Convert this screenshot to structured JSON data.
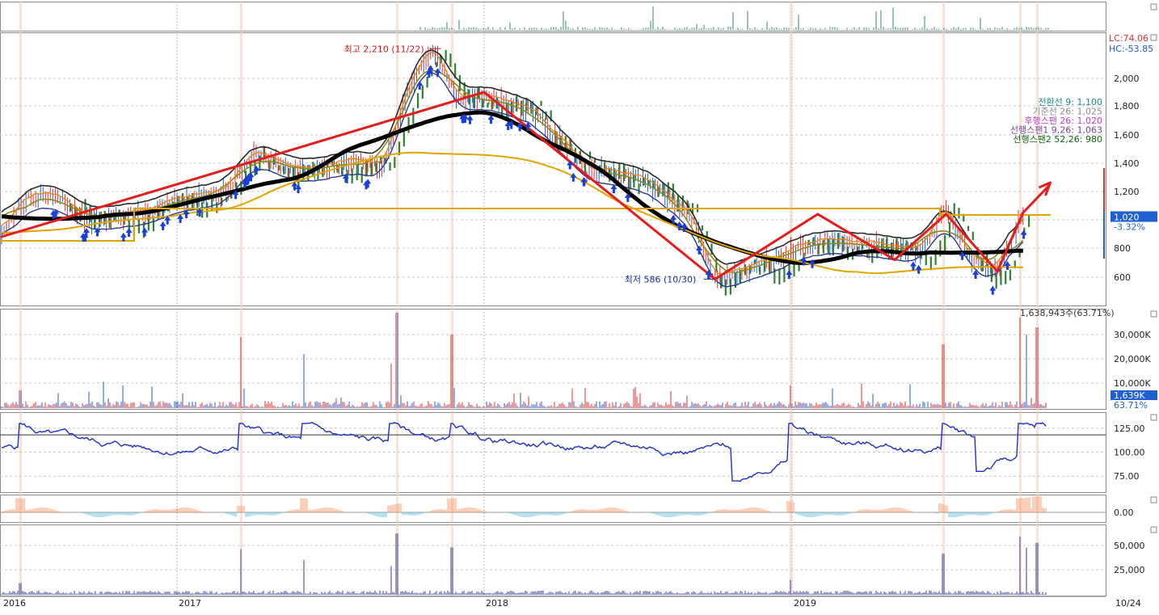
{
  "colors": {
    "price_up": "#e03030",
    "price_down": "#1f5fd0",
    "ma_long": "#000000",
    "ma_mid": "#6a6a6a",
    "ma_yellow": "#e0a500",
    "trend_arrow": "#e51c1c",
    "ichimoku_cloud": "#0a6b10",
    "bollinger": "#000000",
    "buy_signal": "#1b3fd6",
    "volume_up": "#e03030",
    "volume_down": "#1f5fd0",
    "osc_line": "#1d2fc8",
    "macd_pos": "#f4a070",
    "macd_neg": "#6ec6e0",
    "accent_orange": "#f08010",
    "ichimoku_leading1": "#7a3f9a",
    "ichimoku_leading2": "#116611"
  },
  "xaxis": {
    "labels": [
      "2016",
      "2017",
      "2018",
      "2019"
    ],
    "right_label": "10/24"
  },
  "price_panel": {
    "yticks": [
      "2,000",
      "1,800",
      "1,600",
      "1,400",
      "1,200",
      "800",
      "600"
    ],
    "lc_label": "LC:74.06",
    "hc_label": "HC:-53.85",
    "high_annotation": "최고 2,210 (11/22)",
    "low_annotation": "최저 586 (10/30)",
    "current_price": "1,020",
    "current_change": "-3.32%",
    "legend": [
      {
        "text": "전환선 9: 1,100",
        "color": "#1a8a8a"
      },
      {
        "text": "기준선 26: 1,025",
        "color": "#8a8a8a"
      },
      {
        "text": "후행스팬 26: 1,020",
        "color": "#c23fc2"
      },
      {
        "text": "선행스팬1 9,26: 1,063",
        "color": "#7a3f9a"
      },
      {
        "text": "선행스팬2 52,26: 980",
        "color": "#116611"
      }
    ]
  },
  "volume_panel": {
    "yticks": [
      "30,000K",
      "20,000K",
      "10,000K"
    ],
    "max_label": "1,638,943주(63.71%)",
    "current_label": "1,639K",
    "current_pct": "63.71%"
  },
  "osc_panel": {
    "yticks": [
      "125.00",
      "100.00",
      "75.00"
    ]
  },
  "macd_panel": {
    "yticks": [
      "0.00"
    ]
  },
  "vol2_panel": {
    "yticks": [
      "50,000",
      "25,000"
    ]
  },
  "chart_data": {
    "type": "line",
    "title": "",
    "price_points": [
      {
        "date": "2016-01",
        "close": 930
      },
      {
        "date": "2016-03",
        "close": 1180
      },
      {
        "date": "2016-05",
        "close": 1150
      },
      {
        "date": "2016-07",
        "close": 1000
      },
      {
        "date": "2016-09",
        "close": 1020
      },
      {
        "date": "2016-11",
        "close": 1060
      },
      {
        "date": "2017-01",
        "close": 1120
      },
      {
        "date": "2017-03",
        "close": 1200
      },
      {
        "date": "2017-04",
        "close": 1480
      },
      {
        "date": "2017-06",
        "close": 1330
      },
      {
        "date": "2017-08",
        "close": 1420
      },
      {
        "date": "2017-09",
        "close": 1350
      },
      {
        "date": "2017-10",
        "close": 1900
      },
      {
        "date": "2017-11",
        "close": 2210
      },
      {
        "date": "2017-12",
        "close": 1850
      },
      {
        "date": "2018-01",
        "close": 1870
      },
      {
        "date": "2018-03",
        "close": 1750
      },
      {
        "date": "2018-05",
        "close": 1350
      },
      {
        "date": "2018-07",
        "close": 1300
      },
      {
        "date": "2018-09",
        "close": 1050
      },
      {
        "date": "2018-10",
        "close": 586
      },
      {
        "date": "2018-12",
        "close": 700
      },
      {
        "date": "2019-02",
        "close": 850
      },
      {
        "date": "2019-04",
        "close": 820
      },
      {
        "date": "2019-06",
        "close": 780
      },
      {
        "date": "2019-07",
        "close": 1080
      },
      {
        "date": "2019-08",
        "close": 720
      },
      {
        "date": "2019-09",
        "close": 640
      },
      {
        "date": "2019-10",
        "close": 1020
      }
    ],
    "trend_segments": [
      {
        "from": {
          "date": "2016-01",
          "value": 880
        },
        "to": {
          "date": "2018-01",
          "value": 1900
        }
      },
      {
        "from": {
          "date": "2018-01",
          "value": 1900
        },
        "to": {
          "date": "2018-10",
          "value": 586
        }
      },
      {
        "from": {
          "date": "2018-10",
          "value": 586
        },
        "to": {
          "date": "2019-02",
          "value": 1040
        }
      },
      {
        "from": {
          "date": "2019-02",
          "value": 1040
        },
        "to": {
          "date": "2019-05",
          "value": 720
        }
      },
      {
        "from": {
          "date": "2019-05",
          "value": 720
        },
        "to": {
          "date": "2019-07",
          "value": 1040
        }
      },
      {
        "from": {
          "date": "2019-07",
          "value": 1040
        },
        "to": {
          "date": "2019-09",
          "value": 640
        }
      },
      {
        "from": {
          "date": "2019-09",
          "value": 640
        },
        "to": {
          "date": "2019-10",
          "value": 1050
        }
      },
      {
        "from": {
          "date": "2019-10",
          "value": 1050
        },
        "to": {
          "date": "2019-11",
          "value": 1240
        }
      }
    ],
    "ylim": [
      500,
      2250
    ]
  }
}
